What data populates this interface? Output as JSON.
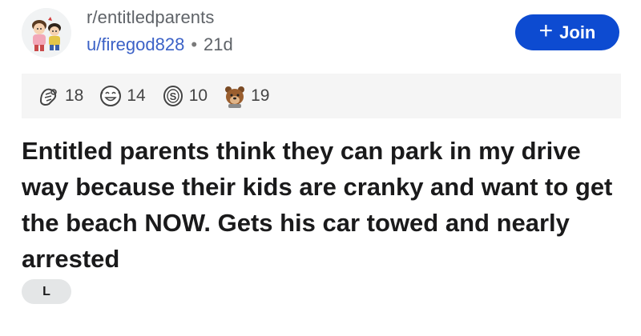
{
  "post": {
    "subreddit": "r/entitledparents",
    "username": "u/firegod828",
    "age": "21d",
    "title": "Entitled parents think they can park in my drive way because their kids are cranky and want to get the beach NOW. Gets his car towed and nearly arrested",
    "flair": "L"
  },
  "join": {
    "label": "Join",
    "icon": "plus-icon"
  },
  "awards": [
    {
      "icon": "wholesome-award-icon",
      "count": "18"
    },
    {
      "icon": "laughing-face-award-icon",
      "count": "14"
    },
    {
      "icon": "silver-coin-award-icon",
      "count": "10"
    },
    {
      "icon": "bear-award-icon",
      "count": "19"
    }
  ],
  "colors": {
    "join_button": "#0d4bd1",
    "username": "#3c62c7",
    "awards_bar": "#f5f5f5",
    "flair": "#e4e6e7"
  }
}
